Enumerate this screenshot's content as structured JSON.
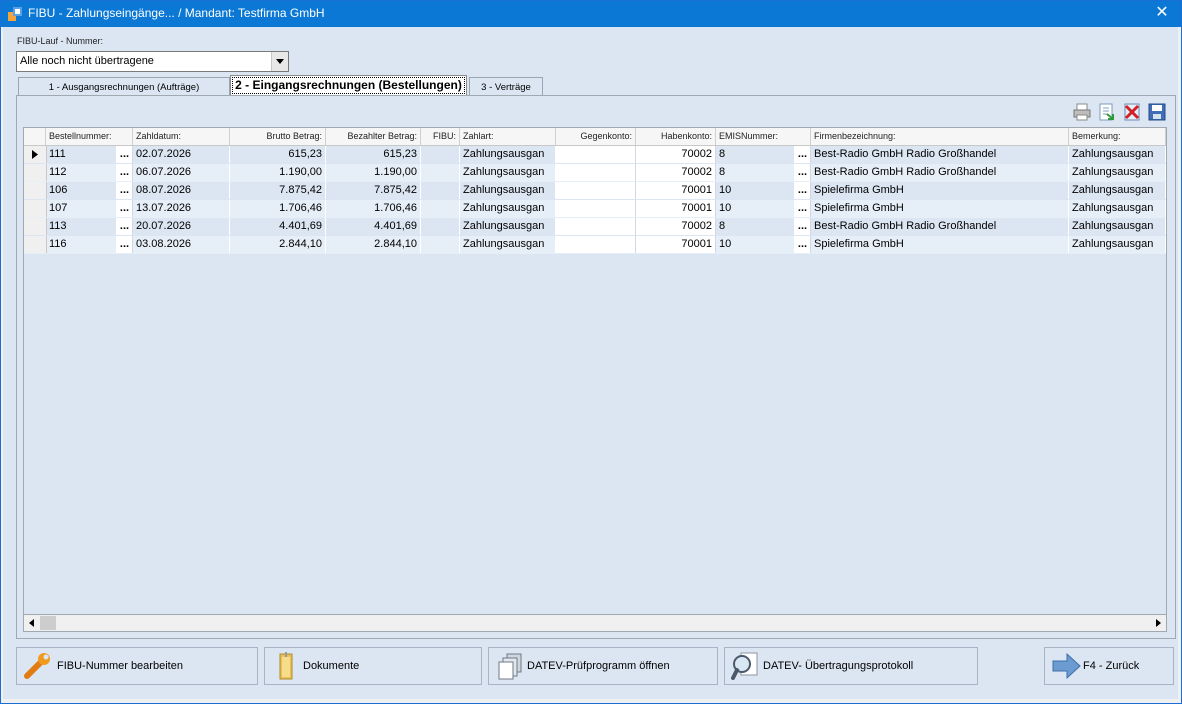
{
  "window": {
    "title": "FIBU - Zahlungseingänge... / Mandant: Testfirma GmbH",
    "close_symbol": "✕"
  },
  "filter": {
    "label": "FIBU-Lauf - Nummer:",
    "value": "Alle noch nicht übertragene"
  },
  "tabs": [
    {
      "label": "1 - Ausgangsrechnungen (Aufträge)",
      "active": false
    },
    {
      "label": "2 - Eingangsrechnungen (Bestellungen)",
      "active": true
    },
    {
      "label": "3 - Verträge",
      "active": false
    }
  ],
  "toolbar": {
    "icons": [
      "print-icon",
      "export-icon",
      "delete-icon",
      "save-icon"
    ]
  },
  "table": {
    "columns": [
      "Bestellnummer:",
      "Zahldatum:",
      "Brutto Betrag:",
      "Bezahlter Betrag:",
      "FIBU:",
      "Zahlart:",
      "Gegenkonto:",
      "Habenkonto:",
      "EMISNummer:",
      "Firmenbezeichnung:",
      "Bemerkung:"
    ],
    "rows": [
      {
        "bestellnummer": "111",
        "ellipsis": "...",
        "zahldatum": "02.07.2026",
        "brutto": "615,23",
        "bezahlt": "615,23",
        "fibu": "",
        "zahlart": "Zahlungsausgan",
        "gegenkonto": "",
        "habenkonto": "70002",
        "emis": "8",
        "ellipsis2": "...",
        "firma": "Best-Radio GmbH Radio Großhandel",
        "bemerkung": "Zahlungsausgan",
        "current": true
      },
      {
        "bestellnummer": "112",
        "ellipsis": "...",
        "zahldatum": "06.07.2026",
        "brutto": "1.190,00",
        "bezahlt": "1.190,00",
        "fibu": "",
        "zahlart": "Zahlungsausgan",
        "gegenkonto": "",
        "habenkonto": "70002",
        "emis": "8",
        "ellipsis2": "...",
        "firma": "Best-Radio GmbH Radio Großhandel",
        "bemerkung": "Zahlungsausgan",
        "current": false
      },
      {
        "bestellnummer": "106",
        "ellipsis": "...",
        "zahldatum": "08.07.2026",
        "brutto": "7.875,42",
        "bezahlt": "7.875,42",
        "fibu": "",
        "zahlart": "Zahlungsausgan",
        "gegenkonto": "",
        "habenkonto": "70001",
        "emis": "10",
        "ellipsis2": "...",
        "firma": "Spielefirma GmbH",
        "bemerkung": "Zahlungsausgan",
        "current": false
      },
      {
        "bestellnummer": "107",
        "ellipsis": "...",
        "zahldatum": "13.07.2026",
        "brutto": "1.706,46",
        "bezahlt": "1.706,46",
        "fibu": "",
        "zahlart": "Zahlungsausgan",
        "gegenkonto": "",
        "habenkonto": "70001",
        "emis": "10",
        "ellipsis2": "...",
        "firma": "Spielefirma GmbH",
        "bemerkung": "Zahlungsausgan",
        "current": false
      },
      {
        "bestellnummer": "113",
        "ellipsis": "...",
        "zahldatum": "20.07.2026",
        "brutto": "4.401,69",
        "bezahlt": "4.401,69",
        "fibu": "",
        "zahlart": "Zahlungsausgan",
        "gegenkonto": "",
        "habenkonto": "70002",
        "emis": "8",
        "ellipsis2": "...",
        "firma": "Best-Radio GmbH Radio Großhandel",
        "bemerkung": "Zahlungsausgan",
        "current": false
      },
      {
        "bestellnummer": "116",
        "ellipsis": "...",
        "zahldatum": "03.08.2026",
        "brutto": "2.844,10",
        "bezahlt": "2.844,10",
        "fibu": "",
        "zahlart": "Zahlungsausgan",
        "gegenkonto": "",
        "habenkonto": "70001",
        "emis": "10",
        "ellipsis2": "...",
        "firma": "Spielefirma GmbH",
        "bemerkung": "Zahlungsausgan",
        "current": false
      }
    ]
  },
  "buttons": {
    "fibu_edit": "FIBU-Nummer bearbeiten",
    "documents": "Dokumente",
    "datev_check": "DATEV-Prüfprogramm öffnen",
    "datev_log": "DATEV- Übertragungsprotokoll",
    "back": "F4 - Zurück"
  },
  "colors": {
    "titlebar": "#0a78d4",
    "background": "#dce6f3",
    "row_alt": "#e6eef8"
  }
}
